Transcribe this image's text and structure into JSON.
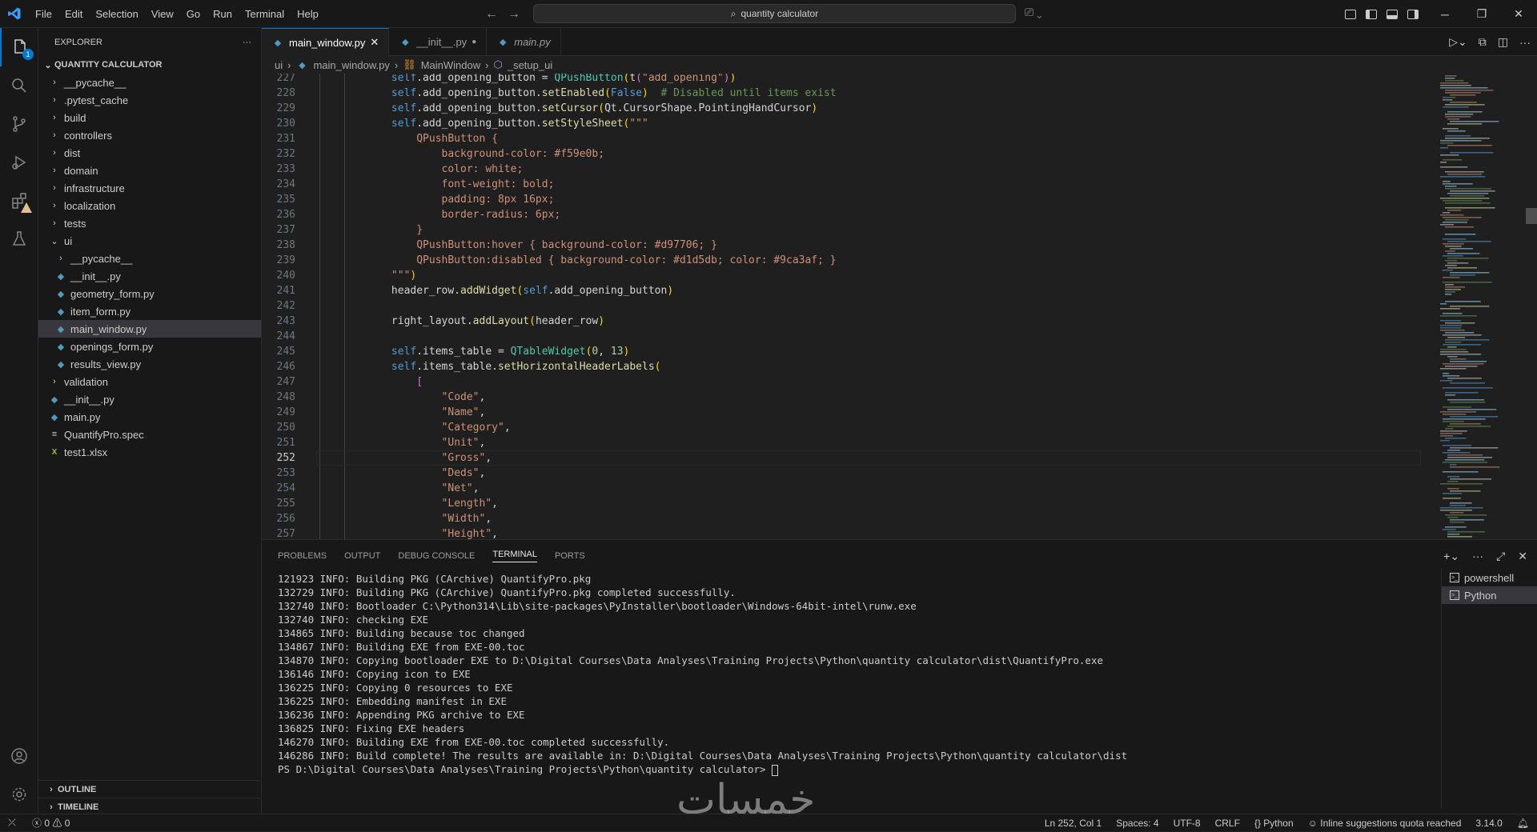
{
  "menu": [
    "File",
    "Edit",
    "Selection",
    "View",
    "Go",
    "Run",
    "Terminal",
    "Help"
  ],
  "search": {
    "text": "quantity calculator"
  },
  "explorer": {
    "title": "EXPLORER",
    "project": "QUANTITY CALCULATOR",
    "items": [
      {
        "label": "__pycache__",
        "type": "folder",
        "depth": 0,
        "open": false
      },
      {
        "label": ".pytest_cache",
        "type": "folder",
        "depth": 0,
        "open": false
      },
      {
        "label": "build",
        "type": "folder",
        "depth": 0,
        "open": false
      },
      {
        "label": "controllers",
        "type": "folder",
        "depth": 0,
        "open": false
      },
      {
        "label": "dist",
        "type": "folder",
        "depth": 0,
        "open": false
      },
      {
        "label": "domain",
        "type": "folder",
        "depth": 0,
        "open": false
      },
      {
        "label": "infrastructure",
        "type": "folder",
        "depth": 0,
        "open": false
      },
      {
        "label": "localization",
        "type": "folder",
        "depth": 0,
        "open": false
      },
      {
        "label": "tests",
        "type": "folder",
        "depth": 0,
        "open": false
      },
      {
        "label": "ui",
        "type": "folder",
        "depth": 0,
        "open": true
      },
      {
        "label": "__pycache__",
        "type": "folder",
        "depth": 1,
        "open": false
      },
      {
        "label": "__init__.py",
        "type": "py",
        "depth": 1
      },
      {
        "label": "geometry_form.py",
        "type": "py",
        "depth": 1
      },
      {
        "label": "item_form.py",
        "type": "py",
        "depth": 1
      },
      {
        "label": "main_window.py",
        "type": "py",
        "depth": 1,
        "selected": true
      },
      {
        "label": "openings_form.py",
        "type": "py",
        "depth": 1
      },
      {
        "label": "results_view.py",
        "type": "py",
        "depth": 1
      },
      {
        "label": "validation",
        "type": "folder",
        "depth": 0,
        "open": false
      },
      {
        "label": "__init__.py",
        "type": "py",
        "depth": 0
      },
      {
        "label": "main.py",
        "type": "py",
        "depth": 0
      },
      {
        "label": "QuantifyPro.spec",
        "type": "spec",
        "depth": 0
      },
      {
        "label": "test1.xlsx",
        "type": "xlsx",
        "depth": 0
      }
    ],
    "outline": "OUTLINE",
    "timeline": "TIMELINE"
  },
  "activity_badge": "1",
  "tabs": [
    {
      "label": "main_window.py",
      "active": true,
      "state": "close"
    },
    {
      "label": "__init__.py",
      "active": false,
      "state": "dirty"
    },
    {
      "label": "main.py",
      "active": false,
      "state": "italic"
    }
  ],
  "breadcrumb": [
    "ui",
    "main_window.py",
    "MainWindow",
    "_setup_ui"
  ],
  "editor": {
    "current_line": 252,
    "lines": [
      {
        "n": 227,
        "t": [
          [
            "            ",
            "pl"
          ],
          [
            "self",
            "kw"
          ],
          [
            ".add_opening_button = ",
            "pl"
          ],
          [
            "QPushButton",
            "cl"
          ],
          [
            "(",
            "bl"
          ],
          [
            "t",
            "fn"
          ],
          [
            "(",
            "pu"
          ],
          [
            "\"add_opening\"",
            "str"
          ],
          [
            ")",
            "pu"
          ],
          [
            ")",
            "bl"
          ]
        ]
      },
      {
        "n": 228,
        "t": [
          [
            "            ",
            "pl"
          ],
          [
            "self",
            "kw"
          ],
          [
            ".add_opening_button.",
            "pl"
          ],
          [
            "setEnabled",
            "fn"
          ],
          [
            "(",
            "bl"
          ],
          [
            "False",
            "kw"
          ],
          [
            ")",
            "bl"
          ],
          [
            "  ",
            "pl"
          ],
          [
            "# Disabled until items exist",
            "cm"
          ]
        ]
      },
      {
        "n": 229,
        "t": [
          [
            "            ",
            "pl"
          ],
          [
            "self",
            "kw"
          ],
          [
            ".add_opening_button.",
            "pl"
          ],
          [
            "setCursor",
            "fn"
          ],
          [
            "(",
            "bl"
          ],
          [
            "Qt.CursorShape.PointingHandCursor",
            "pl"
          ],
          [
            ")",
            "bl"
          ]
        ]
      },
      {
        "n": 230,
        "t": [
          [
            "            ",
            "pl"
          ],
          [
            "self",
            "kw"
          ],
          [
            ".add_opening_button.",
            "pl"
          ],
          [
            "setStyleSheet",
            "fn"
          ],
          [
            "(",
            "bl"
          ],
          [
            "\"\"\"",
            "str"
          ]
        ]
      },
      {
        "n": 231,
        "t": [
          [
            "                QPushButton {",
            "str"
          ]
        ]
      },
      {
        "n": 232,
        "t": [
          [
            "                    background-color: #f59e0b;",
            "str"
          ]
        ]
      },
      {
        "n": 233,
        "t": [
          [
            "                    color: white;",
            "str"
          ]
        ]
      },
      {
        "n": 234,
        "t": [
          [
            "                    font-weight: bold;",
            "str"
          ]
        ]
      },
      {
        "n": 235,
        "t": [
          [
            "                    padding: 8px 16px;",
            "str"
          ]
        ]
      },
      {
        "n": 236,
        "t": [
          [
            "                    border-radius: 6px;",
            "str"
          ]
        ]
      },
      {
        "n": 237,
        "t": [
          [
            "                }",
            "str"
          ]
        ]
      },
      {
        "n": 238,
        "t": [
          [
            "                QPushButton:hover { background-color: #d97706; }",
            "str"
          ]
        ]
      },
      {
        "n": 239,
        "t": [
          [
            "                QPushButton:disabled { background-color: #d1d5db; color: #9ca3af; }",
            "str"
          ]
        ]
      },
      {
        "n": 240,
        "t": [
          [
            "            \"\"\"",
            "str"
          ],
          [
            ")",
            "bl"
          ]
        ]
      },
      {
        "n": 241,
        "t": [
          [
            "            header_row.",
            "pl"
          ],
          [
            "addWidget",
            "fn"
          ],
          [
            "(",
            "bl"
          ],
          [
            "self",
            "kw"
          ],
          [
            ".add_opening_button",
            "pl"
          ],
          [
            ")",
            "bl"
          ]
        ]
      },
      {
        "n": 242,
        "t": [
          [
            "",
            "pl"
          ]
        ]
      },
      {
        "n": 243,
        "t": [
          [
            "            right_layout.",
            "pl"
          ],
          [
            "addLayout",
            "fn"
          ],
          [
            "(",
            "bl"
          ],
          [
            "header_row",
            "pl"
          ],
          [
            ")",
            "bl"
          ]
        ]
      },
      {
        "n": 244,
        "t": [
          [
            "",
            "pl"
          ]
        ]
      },
      {
        "n": 245,
        "t": [
          [
            "            ",
            "pl"
          ],
          [
            "self",
            "kw"
          ],
          [
            ".items_table = ",
            "pl"
          ],
          [
            "QTableWidget",
            "cl"
          ],
          [
            "(",
            "bl"
          ],
          [
            "0",
            "nm"
          ],
          [
            ", ",
            "pl"
          ],
          [
            "13",
            "nm"
          ],
          [
            ")",
            "bl"
          ]
        ]
      },
      {
        "n": 246,
        "t": [
          [
            "            ",
            "pl"
          ],
          [
            "self",
            "kw"
          ],
          [
            ".items_table.",
            "pl"
          ],
          [
            "setHorizontalHeaderLabels",
            "fn"
          ],
          [
            "(",
            "bl"
          ]
        ]
      },
      {
        "n": 247,
        "t": [
          [
            "                ",
            "pl"
          ],
          [
            "[",
            "pu"
          ]
        ]
      },
      {
        "n": 248,
        "t": [
          [
            "                    ",
            "pl"
          ],
          [
            "\"Code\"",
            "str"
          ],
          [
            ",",
            "pl"
          ]
        ]
      },
      {
        "n": 249,
        "t": [
          [
            "                    ",
            "pl"
          ],
          [
            "\"Name\"",
            "str"
          ],
          [
            ",",
            "pl"
          ]
        ]
      },
      {
        "n": 250,
        "t": [
          [
            "                    ",
            "pl"
          ],
          [
            "\"Category\"",
            "str"
          ],
          [
            ",",
            "pl"
          ]
        ]
      },
      {
        "n": 251,
        "t": [
          [
            "                    ",
            "pl"
          ],
          [
            "\"Unit\"",
            "str"
          ],
          [
            ",",
            "pl"
          ]
        ]
      },
      {
        "n": 252,
        "t": [
          [
            "                    ",
            "pl"
          ],
          [
            "\"Gross\"",
            "str"
          ],
          [
            ",",
            "pl"
          ]
        ]
      },
      {
        "n": 253,
        "t": [
          [
            "                    ",
            "pl"
          ],
          [
            "\"Deds\"",
            "str"
          ],
          [
            ",",
            "pl"
          ]
        ]
      },
      {
        "n": 254,
        "t": [
          [
            "                    ",
            "pl"
          ],
          [
            "\"Net\"",
            "str"
          ],
          [
            ",",
            "pl"
          ]
        ]
      },
      {
        "n": 255,
        "t": [
          [
            "                    ",
            "pl"
          ],
          [
            "\"Length\"",
            "str"
          ],
          [
            ",",
            "pl"
          ]
        ]
      },
      {
        "n": 256,
        "t": [
          [
            "                    ",
            "pl"
          ],
          [
            "\"Width\"",
            "str"
          ],
          [
            ",",
            "pl"
          ]
        ]
      },
      {
        "n": 257,
        "t": [
          [
            "                    ",
            "pl"
          ],
          [
            "\"Height\"",
            "str"
          ],
          [
            ",",
            "pl"
          ]
        ]
      }
    ]
  },
  "panel": {
    "tabs": [
      "PROBLEMS",
      "OUTPUT",
      "DEBUG CONSOLE",
      "TERMINAL",
      "PORTS"
    ],
    "active_tab": "TERMINAL",
    "terminal_lines": [
      "121923 INFO: Building PKG (CArchive) QuantifyPro.pkg",
      "132729 INFO: Building PKG (CArchive) QuantifyPro.pkg completed successfully.",
      "132740 INFO: Bootloader C:\\Python314\\Lib\\site-packages\\PyInstaller\\bootloader\\Windows-64bit-intel\\runw.exe",
      "132740 INFO: checking EXE",
      "134865 INFO: Building because toc changed",
      "134867 INFO: Building EXE from EXE-00.toc",
      "134870 INFO: Copying bootloader EXE to D:\\Digital Courses\\Data Analyses\\Training Projects\\Python\\quantity calculator\\dist\\QuantifyPro.exe",
      "136146 INFO: Copying icon to EXE",
      "136225 INFO: Copying 0 resources to EXE",
      "136225 INFO: Embedding manifest in EXE",
      "136236 INFO: Appending PKG archive to EXE",
      "136825 INFO: Fixing EXE headers",
      "146270 INFO: Building EXE from EXE-00.toc completed successfully.",
      "146286 INFO: Build complete! The results are available in: D:\\Digital Courses\\Data Analyses\\Training Projects\\Python\\quantity calculator\\dist"
    ],
    "prompt": "PS D:\\Digital Courses\\Data Analyses\\Training Projects\\Python\\quantity calculator> ",
    "terminals": [
      {
        "label": "powershell",
        "active": false
      },
      {
        "label": "Python",
        "active": true
      }
    ]
  },
  "watermark": "خمسات",
  "status": {
    "errors": "0",
    "warnings": "0",
    "position": "Ln 252, Col 1",
    "spaces": "Spaces: 4",
    "encoding": "UTF-8",
    "eol": "CRLF",
    "language": "Python",
    "copilot": "Inline suggestions quota reached",
    "version": "3.14.0"
  }
}
